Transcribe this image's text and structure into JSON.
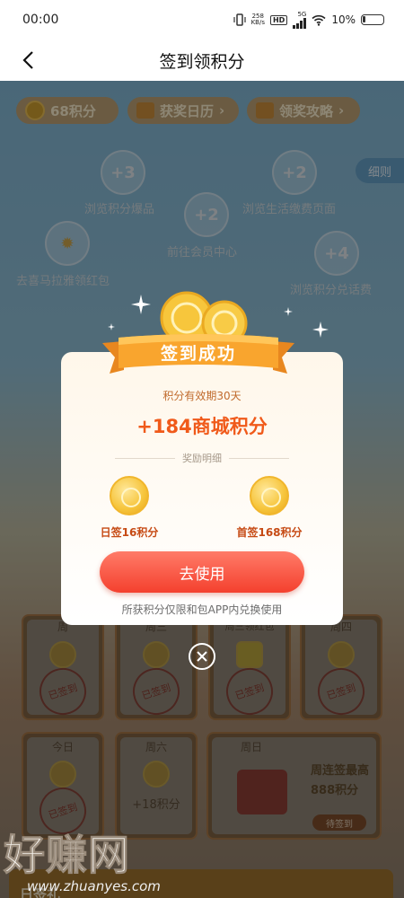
{
  "status_bar": {
    "time": "00:00",
    "net_speed": "258",
    "net_unit": "KB/s",
    "hd": "HD",
    "network": "5G",
    "battery": "10%"
  },
  "header": {
    "title": "签到领积分"
  },
  "top_bar": {
    "points": "68积分",
    "calendar_label": "获奖日历",
    "guide_label": "领奖攻略",
    "detail_label": "细则"
  },
  "tasks": [
    {
      "reward": "+3",
      "label": "浏览积分爆品"
    },
    {
      "reward": "+2",
      "label": "浏览生活缴费页面"
    },
    {
      "reward": "+2",
      "label": "前往会员中心"
    },
    {
      "reward": "",
      "label": "去喜马拉雅领红包"
    },
    {
      "reward": "+4",
      "label": "浏览积分兑话费"
    }
  ],
  "week": [
    {
      "day": "周",
      "status": "已签到"
    },
    {
      "day": "周三",
      "status": "已签到"
    },
    {
      "day": "周三领红包",
      "status": "已签到"
    },
    {
      "day": "周四",
      "status": "已签到"
    },
    {
      "day": "今日",
      "status": "已签到"
    },
    {
      "day": "周六",
      "points": "+18积分"
    },
    {
      "day": "周日",
      "title": "周连签最高",
      "points": "888积分",
      "button": "待签到"
    }
  ],
  "bottom": {
    "label": "日签礼"
  },
  "modal": {
    "title": "签到成功",
    "validity": "积分有效期30天",
    "amount": "+184商城积分",
    "detail_header": "奖励明细",
    "rewards": [
      {
        "label": "日签16积分"
      },
      {
        "label": "首签168积分"
      }
    ],
    "button": "去使用",
    "note": "所获积分仅限和包APP内兑换使用"
  },
  "watermark": {
    "big": "好赚网",
    "small": "www.zhuanyes.com"
  }
}
